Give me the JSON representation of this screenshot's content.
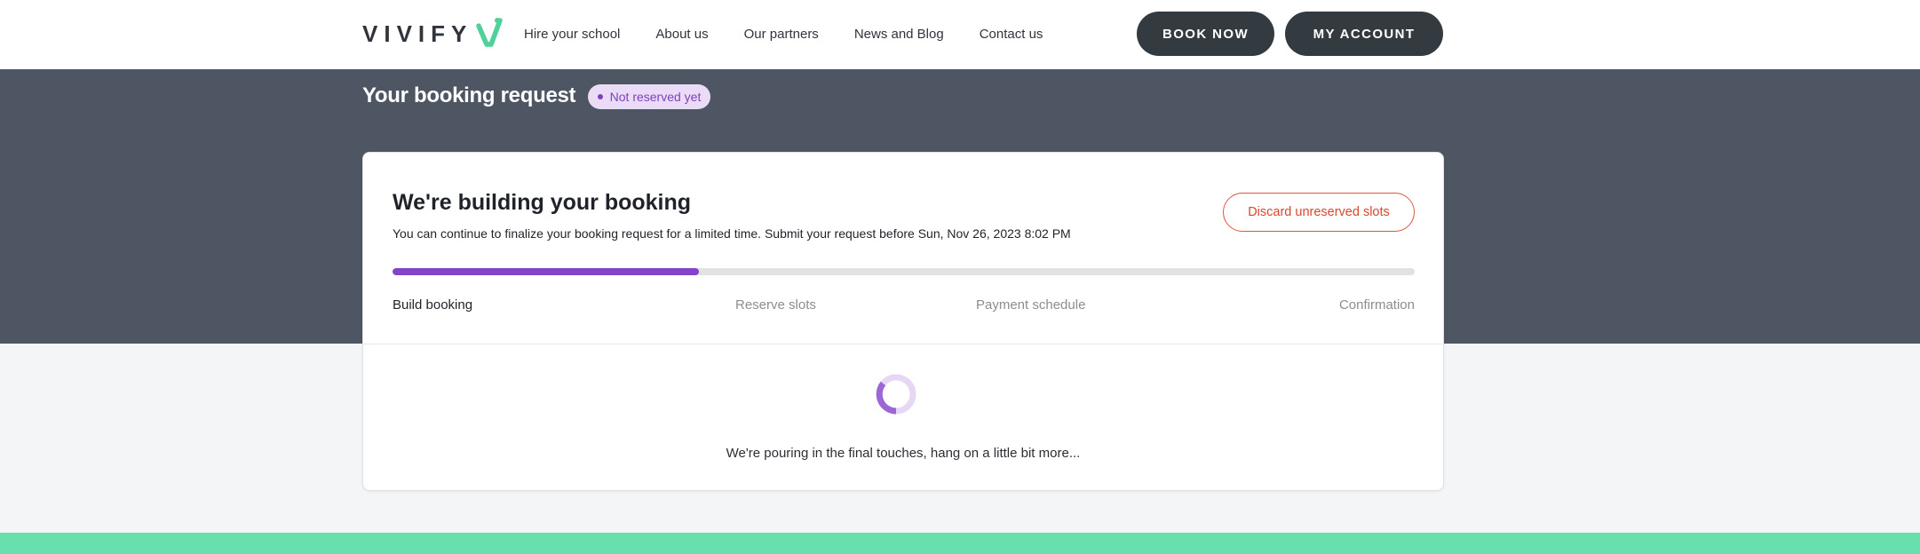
{
  "header": {
    "logo_text": "VIVIFY",
    "nav": [
      "Hire your school",
      "About us",
      "Our partners",
      "News and Blog",
      "Contact us"
    ],
    "book_now": "BOOK NOW",
    "my_account": "MY ACCOUNT"
  },
  "page": {
    "title": "Your booking request",
    "status": "Not reserved yet"
  },
  "card": {
    "title": "We're building your booking",
    "subtitle": "You can continue to finalize your booking request for a limited time. Submit your request before Sun, Nov 26, 2023 8:02 PM",
    "discard_label": "Discard unreserved slots",
    "progress_fraction": 0.3,
    "steps": [
      "Build booking",
      "Reserve slots",
      "Payment schedule",
      "Confirmation"
    ],
    "active_step_index": 0,
    "loading_text": "We're pouring in the final touches, hang on a little bit more..."
  },
  "colors": {
    "accent": "#8244c9",
    "hero_bg": "#4f5663",
    "footer": "#68e0ad",
    "logo_mark": "#4fd19a",
    "danger": "#d8462d"
  },
  "icons": {
    "logo_mark": "v-checkmark-logo-icon",
    "spinner": "loading-spinner-icon",
    "status_dot": "status-dot-icon"
  }
}
